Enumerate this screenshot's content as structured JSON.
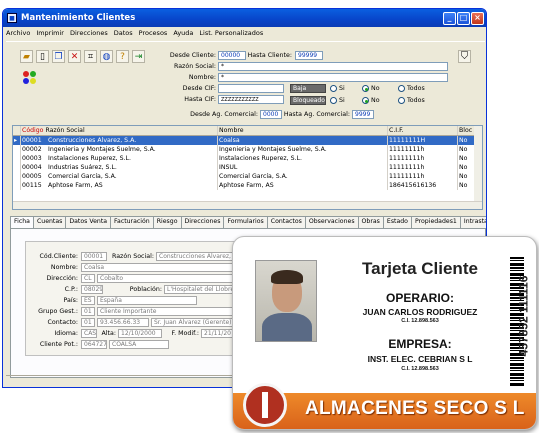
{
  "window": {
    "title": "Mantenimiento Clientes",
    "min": "_",
    "max": "□",
    "close": "×"
  },
  "menu": [
    "Archivo",
    "Imprimir",
    "Direcciones",
    "Datos",
    "Procesos",
    "Ayuda",
    "List. Personalizados"
  ],
  "toolbar": {
    "icons": [
      "open-icon",
      "new-icon",
      "copy-icon",
      "delete-icon",
      "clear-icon",
      "globe-icon",
      "help-icon",
      "exit-icon"
    ]
  },
  "filters": {
    "desde_cliente_label": "Desde Cliente:",
    "desde_cliente": "00000",
    "hasta_cliente_label": "Hasta Cliente:",
    "hasta_cliente": "99999",
    "razon_label": "Razón Social:",
    "razon": "*",
    "nombre_label": "Nombre:",
    "nombre": "*",
    "desde_cif_label": "Desde CIF:",
    "desde_cif": "",
    "hasta_cif_label": "Hasta CIF:",
    "hasta_cif": "ZZZZZZZZZZZ",
    "baja_label": "Baja",
    "bloqueado_label": "Bloqueado",
    "si": "Si",
    "no": "No",
    "todos": "Todos",
    "desde_ag_label": "Desde Ag. Comercial:",
    "desde_ag": "0000",
    "hasta_ag_label": "Hasta Ag. Comercial:",
    "hasta_ag": "9999"
  },
  "grid": {
    "headers": [
      "Código",
      "Razón Social",
      "Nombre",
      "C.I.F.",
      "Bloc"
    ],
    "rows": [
      {
        "code": "00001",
        "razon": "Construcciones Alvarez, S.A.",
        "nombre": "Coalsa",
        "cif": "11111111H",
        "bloc": "No"
      },
      {
        "code": "00002",
        "razon": "Ingenieria y Montajes Suelme, S.A.",
        "nombre": "Ingenieria y Montajes Suelme, S.A.",
        "cif": "11111111h",
        "bloc": "No"
      },
      {
        "code": "00003",
        "razon": "Instalaciones Ruperez, S.L.",
        "nombre": "Instalaciones Ruperez, S.L.",
        "cif": "11111111h",
        "bloc": "No"
      },
      {
        "code": "00004",
        "razon": "Industrias Suárez, S.L.",
        "nombre": "INSUL",
        "cif": "11111111h",
        "bloc": "No"
      },
      {
        "code": "00005",
        "razon": "Comercial García, S.A.",
        "nombre": "Comercial García, S.A.",
        "cif": "11111111h",
        "bloc": "No"
      },
      {
        "code": "00115",
        "razon": "Aphtose Farm, AS",
        "nombre": "Aphtose Farm, AS",
        "cif": "186415616136",
        "bloc": "No"
      }
    ]
  },
  "tabs": [
    "Ficha",
    "Cuentas",
    "Datos Venta",
    "Facturación",
    "Riesgo",
    "Direcciones",
    "Formularios",
    "Contactos",
    "Observaciones",
    "Obras",
    "Estado",
    "Propiedades1",
    "Intrastat"
  ],
  "detail": {
    "cod_label": "Cód.Cliente:",
    "cod": "00001",
    "razon_label": "Razón Social:",
    "razon": "Construcciones Alvarez, S.A.",
    "nombre_label": "Nombre:",
    "nombre": "Coalsa",
    "dir_label": "Dirección:",
    "dir_tipo": "CL",
    "dir": "Cobalto",
    "cp_label": "C.P.:",
    "cp": "08029",
    "pob_label": "Población:",
    "pob": "L'Hospitalet del Llobregat",
    "pais_label": "País:",
    "pais_code": "ES",
    "pais": "España",
    "grupo_label": "Grupo Gest.:",
    "grupo_code": "01",
    "grupo": "Cliente Importante",
    "contacto_label": "Contacto:",
    "contacto_code": "01",
    "telefono": "93.456.66.33",
    "contacto": "Sr. Juan Alvarez (Gerente)",
    "idioma_label": "Idioma:",
    "idioma": "CAS",
    "alta_label": "Alta:",
    "alta": "12/10/2000",
    "fmod_label": "F. Modif.:",
    "fmod": "21/11/20",
    "pot_label": "Cliente Pot.:",
    "pot_code": "064727",
    "pot": "COALSA"
  },
  "card": {
    "title": "Tarjeta Cliente",
    "role_label": "OPERARIO:",
    "person": "JUAN CARLOS RODRIGUEZ",
    "person_ci": "C.I. 12.898.563",
    "company_label": "EMPRESA:",
    "company": "INST. ELEC. CEBRIAN S L",
    "company_ci": "C.I. 12.898.563",
    "barcode_number": "457852 111116",
    "brand": "ALMACENES SECO S L"
  }
}
